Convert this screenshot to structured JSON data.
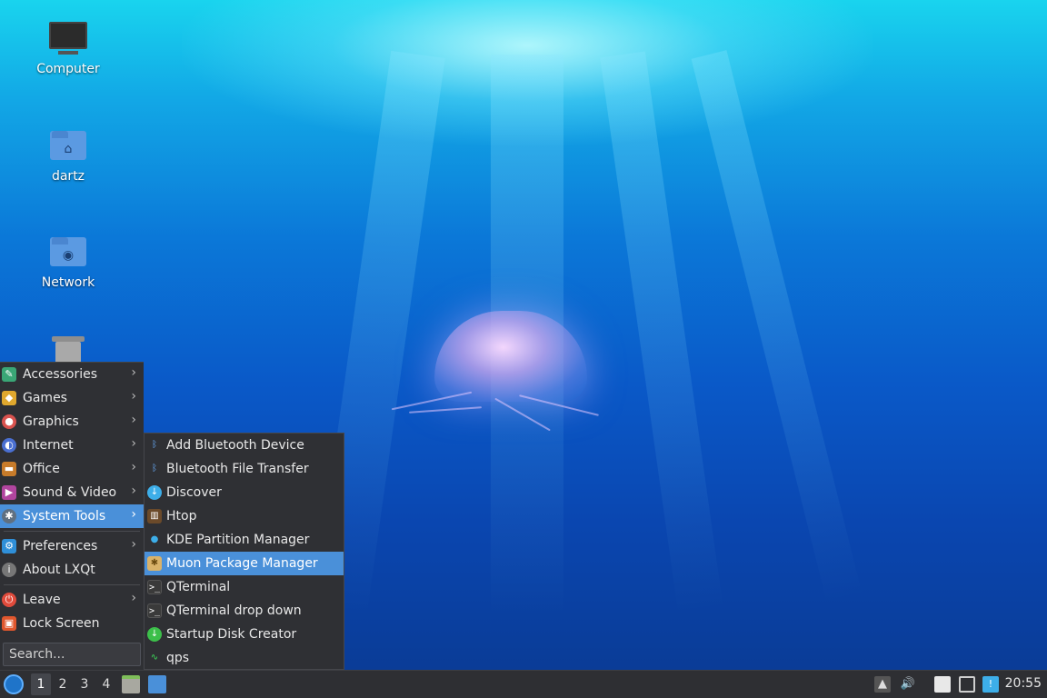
{
  "desktop": {
    "icons": [
      {
        "label": "Computer"
      },
      {
        "label": "dartz"
      },
      {
        "label": "Network"
      }
    ]
  },
  "menu": {
    "items": [
      {
        "label": "Accessories",
        "icon": "accessories-icon",
        "color": "#3aa676"
      },
      {
        "label": "Games",
        "icon": "games-icon",
        "color": "#e0a82e"
      },
      {
        "label": "Graphics",
        "icon": "graphics-icon",
        "color": "#d9534f"
      },
      {
        "label": "Internet",
        "icon": "internet-icon",
        "color": "#4a6fd1"
      },
      {
        "label": "Office",
        "icon": "office-icon",
        "color": "#c77b2a"
      },
      {
        "label": "Sound & Video",
        "icon": "sound-video-icon",
        "color": "#b1459e"
      },
      {
        "label": "System Tools",
        "icon": "system-tools-icon",
        "color": "#607080"
      },
      {
        "label": "Preferences",
        "icon": "preferences-icon",
        "color": "#2f8fd8"
      },
      {
        "label": "About LXQt",
        "icon": "info-icon",
        "color": "#777777"
      },
      {
        "label": "Leave",
        "icon": "power-icon",
        "color": "#e04b3c"
      },
      {
        "label": "Lock Screen",
        "icon": "lock-icon",
        "color": "#e0572e"
      }
    ],
    "search_placeholder": "Search..."
  },
  "submenu": {
    "items": [
      {
        "label": "Add Bluetooth Device",
        "icon": "bluetooth-icon"
      },
      {
        "label": "Bluetooth File Transfer",
        "icon": "bluetooth-icon"
      },
      {
        "label": "Discover",
        "icon": "discover-icon"
      },
      {
        "label": "Htop",
        "icon": "htop-icon"
      },
      {
        "label": "KDE Partition Manager",
        "icon": "partition-icon"
      },
      {
        "label": "Muon Package Manager",
        "icon": "muon-icon"
      },
      {
        "label": "QTerminal",
        "icon": "terminal-icon"
      },
      {
        "label": "QTerminal drop down",
        "icon": "terminal-icon"
      },
      {
        "label": "Startup Disk Creator",
        "icon": "usb-icon"
      },
      {
        "label": "qps",
        "icon": "qps-icon"
      }
    ]
  },
  "taskbar": {
    "desktops": [
      "1",
      "2",
      "3",
      "4"
    ],
    "clock": "20:55"
  },
  "colors": {
    "accent": "#4a90d9",
    "menu_bg": "#2f3034",
    "taskbar_bg": "#2e2f33"
  }
}
